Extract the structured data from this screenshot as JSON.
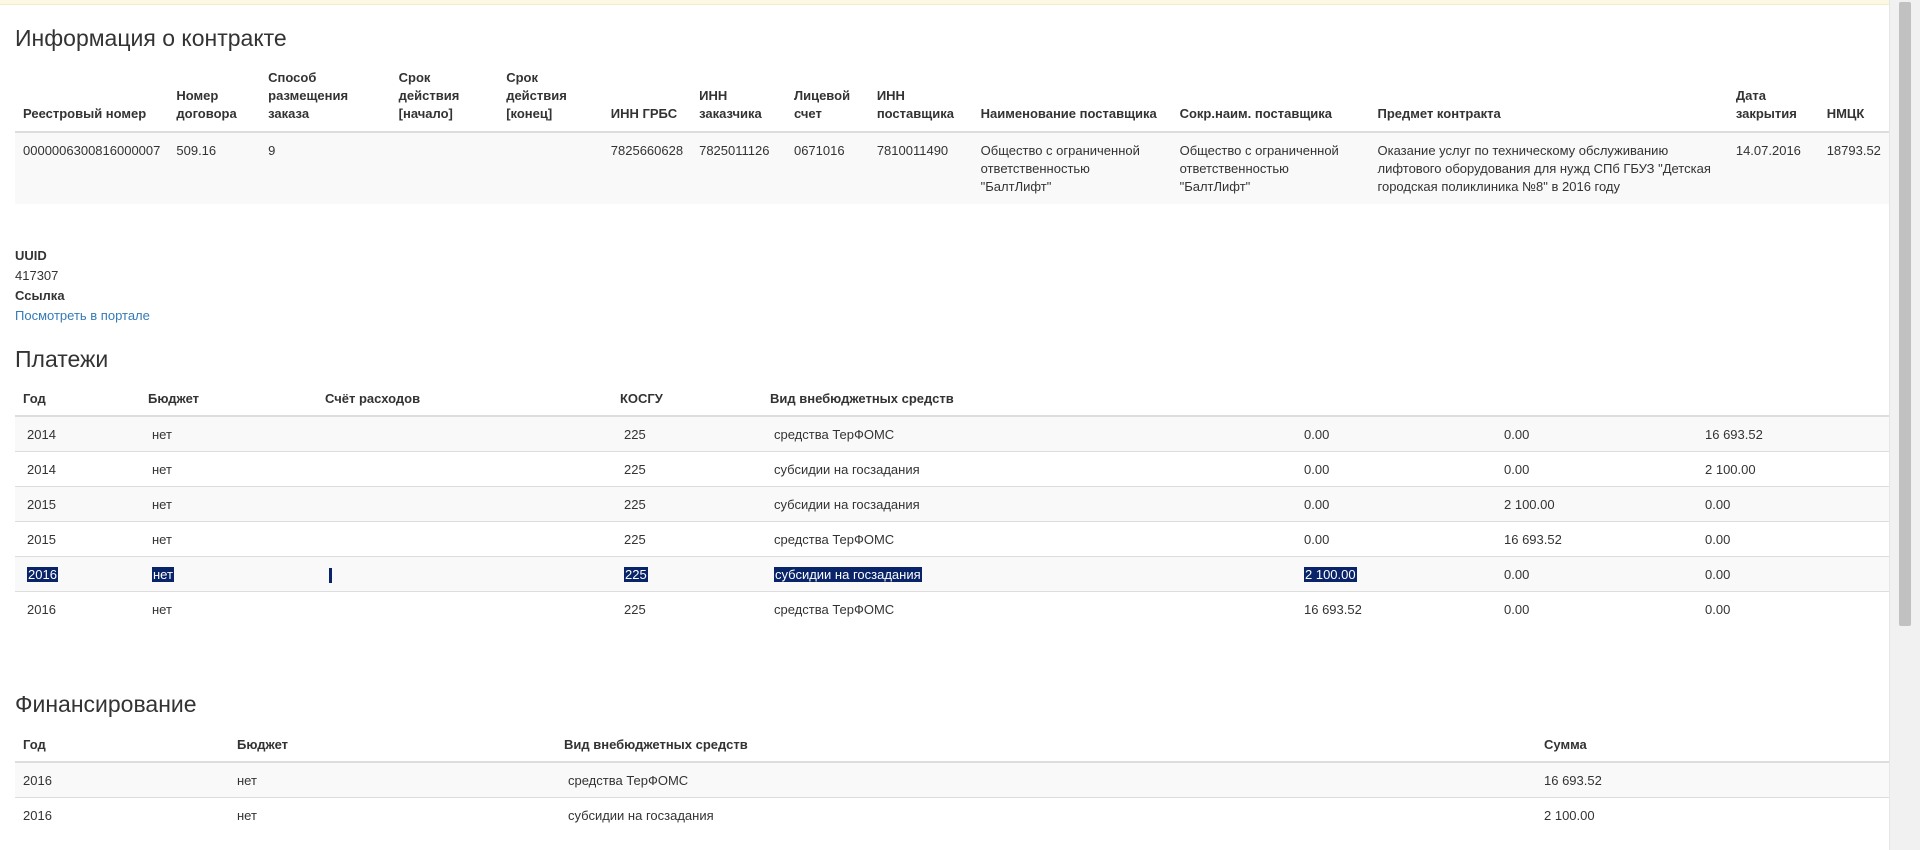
{
  "contract_section": {
    "title": "Информация о контракте",
    "headers": [
      [
        "Реестровый номер"
      ],
      [
        "Номер",
        "договора"
      ],
      [
        "Способ",
        "размещения",
        "заказа"
      ],
      [
        "Срок",
        "действия",
        "[начало]"
      ],
      [
        "Срок",
        "действия",
        "[конец]"
      ],
      [
        "ИНН ГРБС"
      ],
      [
        "ИНН",
        "заказчика"
      ],
      [
        "Лицевой",
        "счет"
      ],
      [
        "ИНН",
        "поставщика"
      ],
      [
        "Наименование поставщика"
      ],
      [
        "Сокр.наим. поставщика"
      ],
      [
        "Предмет контракта"
      ],
      [
        "Дата",
        "закрытия"
      ],
      [
        "НМЦК"
      ]
    ],
    "row": {
      "registry_number": "0000006300816000007",
      "contract_number": "509.16",
      "placement_method": "9",
      "term_start": "",
      "term_end": "",
      "inn_grbs": "7825660628",
      "inn_customer": "7825011126",
      "account": "0671016",
      "inn_supplier": "7810011490",
      "supplier_name": "Общество с ограниченной ответственностью \"БалтЛифт\"",
      "supplier_short": "Общество с ограниченной ответственностью \"БалтЛифт\"",
      "subject": "Оказание услуг по техническому обслуживанию лифтового оборудования для нужд СПб ГБУЗ \"Детская городская поликлиника №8\" в 2016 году",
      "closing_date": "14.07.2016",
      "nmck": "18793.52"
    }
  },
  "meta": {
    "uuid_label": "UUID",
    "uuid_value": "417307",
    "link_label": "Ссылка",
    "link_text": "Посмотреть в портале"
  },
  "payments_section": {
    "title": "Платежи",
    "headers": [
      "Год",
      "Бюджет",
      "Счёт расходов",
      "КОСГУ",
      "Вид внебюджетных средств",
      "",
      "",
      ""
    ],
    "rows": [
      [
        "2014",
        "нет",
        "",
        "225",
        "средства ТерФОМС",
        "0.00",
        "0.00",
        "16 693.52"
      ],
      [
        "2014",
        "нет",
        "",
        "225",
        "субсидии на госзадания",
        "0.00",
        "0.00",
        "2 100.00"
      ],
      [
        "2015",
        "нет",
        "",
        "225",
        "субсидии на госзадания",
        "0.00",
        "2 100.00",
        "0.00"
      ],
      [
        "2015",
        "нет",
        "",
        "225",
        "средства ТерФОМС",
        "0.00",
        "16 693.52",
        "0.00"
      ],
      [
        "2016",
        "нет",
        "",
        "225",
        "субсидии на госзадания",
        "2 100.00",
        "0.00",
        "0.00"
      ],
      [
        "2016",
        "нет",
        "",
        "225",
        "средства ТерФОМС",
        "16 693.52",
        "0.00",
        "0.00"
      ]
    ],
    "selected_row_index": 4
  },
  "financing_section": {
    "title": "Финансирование",
    "headers": [
      "Год",
      "Бюджет",
      "Вид внебюджетных средств",
      "Сумма"
    ],
    "rows": [
      [
        "2016",
        "нет",
        "средства ТерФОМС",
        "16 693.52"
      ],
      [
        "2016",
        "нет",
        "субсидии на госзадания",
        "2 100.00"
      ]
    ]
  },
  "colors": {
    "link": "#337ab7",
    "selection": "#0a246a",
    "top_alert": "#fcf8e3",
    "row_stripe": "#f9f9f9"
  }
}
